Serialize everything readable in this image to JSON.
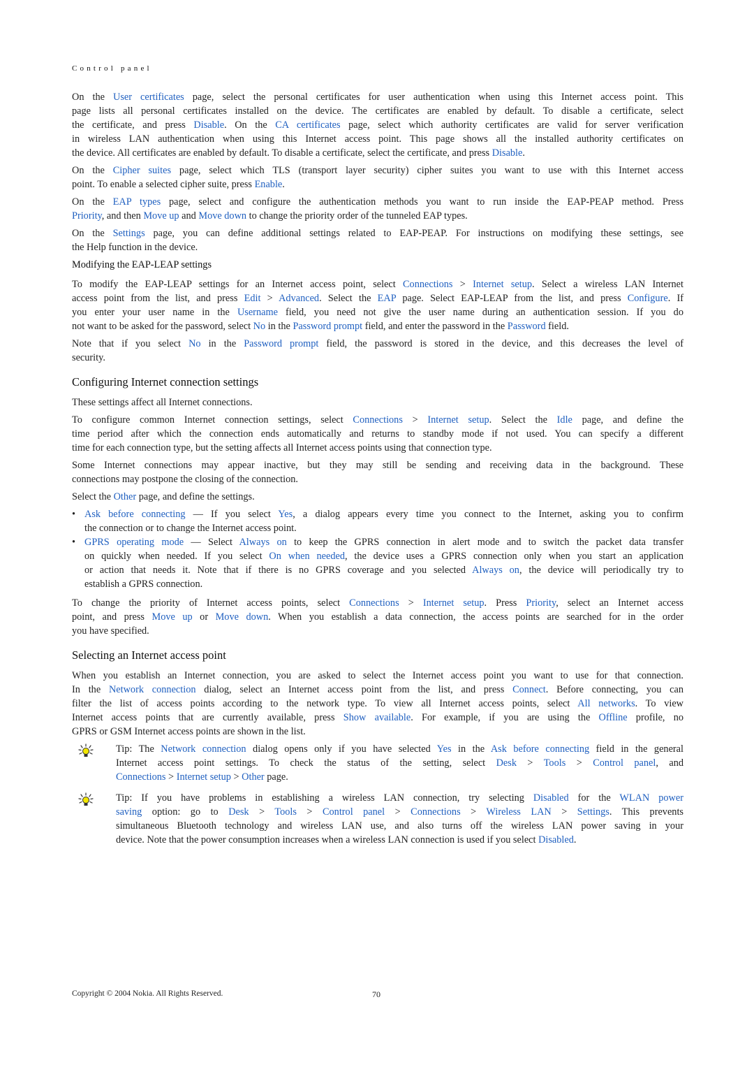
{
  "header": {
    "section": "Control panel"
  },
  "colors": {
    "link": "#2060c0",
    "text": "#222222",
    "tip_icon": "#f2e600"
  },
  "blocks": [
    {
      "type": "para",
      "lines": [
        [
          {
            "t": "On the "
          },
          {
            "t": "User certificates",
            "l": 1
          },
          {
            "t": " page, select the personal certificates for user authentication when using this Internet access point. This"
          }
        ],
        [
          {
            "t": "page lists all personal certificates installed on the device. The certificates are enabled by default. To disable a certificate, select"
          }
        ],
        [
          {
            "t": "the certificate, and press "
          },
          {
            "t": "Disable",
            "l": 1
          },
          {
            "t": ". On the "
          },
          {
            "t": "CA certificates",
            "l": 1
          },
          {
            "t": " page, select which authority certificates are valid for server verification"
          }
        ],
        [
          {
            "t": "in wireless LAN authentication when using this Internet access point. This page shows all the installed authority certificates on"
          }
        ],
        [
          {
            "t": "the device. All certificates are enabled by default. To disable a certificate, select the certificate, and press "
          },
          {
            "t": "Disable",
            "l": 1
          },
          {
            "t": "."
          }
        ]
      ]
    },
    {
      "type": "para",
      "lines": [
        [
          {
            "t": "On the "
          },
          {
            "t": "Cipher suites",
            "l": 1
          },
          {
            "t": " page, select which TLS (transport layer security) cipher suites you want to use with this Internet access"
          }
        ],
        [
          {
            "t": "point. To enable a selected cipher suite, press "
          },
          {
            "t": "Enable",
            "l": 1
          },
          {
            "t": "."
          }
        ]
      ]
    },
    {
      "type": "para",
      "lines": [
        [
          {
            "t": "On the "
          },
          {
            "t": "EAP types",
            "l": 1
          },
          {
            "t": " page, select and configure the authentication methods you want to run inside the EAP-PEAP method. Press"
          }
        ],
        [
          {
            "t": "Priority",
            "l": 1
          },
          {
            "t": ", and then "
          },
          {
            "t": "Move up",
            "l": 1
          },
          {
            "t": " and "
          },
          {
            "t": "Move down",
            "l": 1
          },
          {
            "t": " to change the priority order of the tunneled EAP types."
          }
        ]
      ]
    },
    {
      "type": "para",
      "lines": [
        [
          {
            "t": "On the "
          },
          {
            "t": "Settings",
            "l": 1
          },
          {
            "t": " page, you can define additional settings related to EAP-PEAP. For instructions on modifying these settings, see"
          }
        ],
        [
          {
            "t": "the Help function in the device."
          }
        ]
      ]
    },
    {
      "type": "subhead",
      "text": "Modifying the EAP-LEAP settings"
    },
    {
      "type": "para",
      "lines": [
        [
          {
            "t": "To modify the EAP-LEAP settings for an Internet access point, select "
          },
          {
            "t": "Connections",
            "l": 1
          },
          {
            "t": " > "
          },
          {
            "t": "Internet setup",
            "l": 1
          },
          {
            "t": ". Select a wireless LAN Internet"
          }
        ],
        [
          {
            "t": "access point from the list, and press "
          },
          {
            "t": "Edit",
            "l": 1
          },
          {
            "t": " > "
          },
          {
            "t": "Advanced",
            "l": 1
          },
          {
            "t": ". Select the "
          },
          {
            "t": "EAP",
            "l": 1
          },
          {
            "t": " page. Select EAP-LEAP from the list, and press "
          },
          {
            "t": "Configure",
            "l": 1
          },
          {
            "t": ". If"
          }
        ],
        [
          {
            "t": "you enter your user name in the "
          },
          {
            "t": "Username",
            "l": 1
          },
          {
            "t": " field, you need not give the user name during an authentication session. If you do"
          }
        ],
        [
          {
            "t": "not want to be asked for the password, select "
          },
          {
            "t": "No",
            "l": 1
          },
          {
            "t": " in the "
          },
          {
            "t": "Password prompt",
            "l": 1
          },
          {
            "t": " field, and enter the password in the "
          },
          {
            "t": "Password",
            "l": 1
          },
          {
            "t": " field."
          }
        ]
      ]
    },
    {
      "type": "para",
      "lines": [
        [
          {
            "t": "Note that if you select "
          },
          {
            "t": "No",
            "l": 1
          },
          {
            "t": " in the "
          },
          {
            "t": "Password prompt",
            "l": 1
          },
          {
            "t": " field, the password is stored in the device, and this decreases the level of"
          }
        ],
        [
          {
            "t": "security."
          }
        ]
      ]
    },
    {
      "type": "h2",
      "text": "Configuring Internet connection settings"
    },
    {
      "type": "para",
      "lines": [
        [
          {
            "t": "These settings affect all Internet connections."
          }
        ]
      ]
    },
    {
      "type": "para",
      "lines": [
        [
          {
            "t": "To configure common Internet connection settings, select "
          },
          {
            "t": "Connections",
            "l": 1
          },
          {
            "t": " > "
          },
          {
            "t": "Internet setup",
            "l": 1
          },
          {
            "t": ". Select the "
          },
          {
            "t": "Idle",
            "l": 1
          },
          {
            "t": " page, and define the"
          }
        ],
        [
          {
            "t": "time period after which the connection ends automatically and returns to standby mode if not used. You can specify a different"
          }
        ],
        [
          {
            "t": "time for each connection type, but the setting affects all Internet access points using that connection type."
          }
        ]
      ]
    },
    {
      "type": "para",
      "lines": [
        [
          {
            "t": "Some Internet connections may appear inactive, but they may still be sending and receiving data in the background. These"
          }
        ],
        [
          {
            "t": "connections may postpone the closing of the connection."
          }
        ]
      ]
    },
    {
      "type": "para",
      "lines": [
        [
          {
            "t": "Select the "
          },
          {
            "t": "Other",
            "l": 1
          },
          {
            "t": " page, and define the settings."
          }
        ]
      ]
    },
    {
      "type": "bullets",
      "items": [
        {
          "lines": [
            [
              {
                "t": "Ask before connecting",
                "l": 1
              },
              {
                "t": " — If you select "
              },
              {
                "t": "Yes",
                "l": 1
              },
              {
                "t": ", a dialog appears every time you connect to the Internet, asking you to confirm"
              }
            ],
            [
              {
                "t": "the connection or to change the Internet access point."
              }
            ]
          ]
        },
        {
          "lines": [
            [
              {
                "t": "GPRS operating mode",
                "l": 1
              },
              {
                "t": " — Select "
              },
              {
                "t": "Always on",
                "l": 1
              },
              {
                "t": " to keep the GPRS connection in alert mode and to switch the packet data transfer"
              }
            ],
            [
              {
                "t": "on quickly when needed. If you select "
              },
              {
                "t": "On when needed",
                "l": 1
              },
              {
                "t": ", the device uses a GPRS connection only when you start an application"
              }
            ],
            [
              {
                "t": "or action that needs it. Note that if there is no GPRS coverage and you selected "
              },
              {
                "t": "Always on",
                "l": 1
              },
              {
                "t": ", the device will periodically try to"
              }
            ],
            [
              {
                "t": "establish a GPRS connection."
              }
            ]
          ]
        }
      ]
    },
    {
      "type": "para",
      "lines": [
        [
          {
            "t": "To change the priority of Internet access points, select "
          },
          {
            "t": "Connections",
            "l": 1
          },
          {
            "t": " > "
          },
          {
            "t": "Internet setup",
            "l": 1
          },
          {
            "t": ". Press "
          },
          {
            "t": "Priority",
            "l": 1
          },
          {
            "t": ", select an Internet access"
          }
        ],
        [
          {
            "t": "point, and press "
          },
          {
            "t": "Move up",
            "l": 1
          },
          {
            "t": " or "
          },
          {
            "t": "Move down",
            "l": 1
          },
          {
            "t": ". When you establish a data connection, the access points are searched for in the order"
          }
        ],
        [
          {
            "t": "you have specified."
          }
        ]
      ]
    },
    {
      "type": "h2",
      "text": "Selecting an Internet access point"
    },
    {
      "type": "para",
      "lines": [
        [
          {
            "t": "When you establish an Internet connection, you are asked to select the Internet access point you want to use for that connection."
          }
        ],
        [
          {
            "t": "In the "
          },
          {
            "t": "Network connection",
            "l": 1
          },
          {
            "t": " dialog, select an Internet access point from the list, and press "
          },
          {
            "t": "Connect",
            "l": 1
          },
          {
            "t": ". Before connecting, you can"
          }
        ],
        [
          {
            "t": "filter the list of access points according to the network type. To view all Internet access points, select "
          },
          {
            "t": "All networks",
            "l": 1
          },
          {
            "t": ". To view"
          }
        ],
        [
          {
            "t": "Internet access points that are currently available, press "
          },
          {
            "t": "Show available",
            "l": 1
          },
          {
            "t": ". For example, if you are using the "
          },
          {
            "t": "Offline",
            "l": 1
          },
          {
            "t": " profile, no"
          }
        ],
        [
          {
            "t": "GPRS or GSM Internet access points are shown in the list."
          }
        ]
      ]
    },
    {
      "type": "tip",
      "icon": "lightbulb-tip-icon",
      "lines": [
        [
          {
            "t": "Tip: The "
          },
          {
            "t": "Network connection",
            "l": 1
          },
          {
            "t": " dialog opens only if you have selected "
          },
          {
            "t": "Yes",
            "l": 1
          },
          {
            "t": " in the "
          },
          {
            "t": "Ask before connecting",
            "l": 1
          },
          {
            "t": " field in the general"
          }
        ],
        [
          {
            "t": "Internet access point settings. To check the status of the setting, select "
          },
          {
            "t": "Desk",
            "l": 1
          },
          {
            "t": " > "
          },
          {
            "t": "Tools",
            "l": 1
          },
          {
            "t": " > "
          },
          {
            "t": "Control panel",
            "l": 1
          },
          {
            "t": ", and"
          }
        ],
        [
          {
            "t": "Connections",
            "l": 1
          },
          {
            "t": " > "
          },
          {
            "t": "Internet setup",
            "l": 1
          },
          {
            "t": " > "
          },
          {
            "t": "Other",
            "l": 1
          },
          {
            "t": " page."
          }
        ]
      ]
    },
    {
      "type": "tip",
      "icon": "lightbulb-tip-icon",
      "lines": [
        [
          {
            "t": "Tip:  If you have problems in establishing a wireless LAN connection, try selecting "
          },
          {
            "t": "Disabled",
            "l": 1
          },
          {
            "t": " for the "
          },
          {
            "t": "WLAN power",
            "l": 1
          }
        ],
        [
          {
            "t": "saving",
            "l": 1
          },
          {
            "t": " option: go to "
          },
          {
            "t": "Desk",
            "l": 1
          },
          {
            "t": " > "
          },
          {
            "t": "Tools",
            "l": 1
          },
          {
            "t": " > "
          },
          {
            "t": "Control panel",
            "l": 1
          },
          {
            "t": " > "
          },
          {
            "t": "Connections",
            "l": 1
          },
          {
            "t": " > "
          },
          {
            "t": "Wireless LAN",
            "l": 1
          },
          {
            "t": " > "
          },
          {
            "t": "Settings",
            "l": 1
          },
          {
            "t": ". This prevents"
          }
        ],
        [
          {
            "t": "simultaneous Bluetooth technology and wireless LAN use, and also turns off the wireless LAN power saving in your"
          }
        ],
        [
          {
            "t": "device. Note that the power consumption increases when a wireless LAN connection is used if you select "
          },
          {
            "t": "Disabled",
            "l": 1
          },
          {
            "t": "."
          }
        ]
      ]
    }
  ],
  "footer": {
    "copyright": "Copyright © 2004 Nokia. All Rights Reserved.",
    "page_number": "70"
  }
}
